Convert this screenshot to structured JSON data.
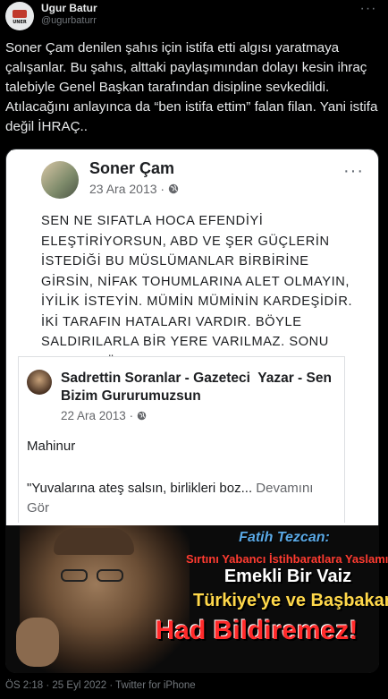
{
  "author": {
    "name": "Ugur Batur",
    "handle": "@ugurbaturr",
    "avatar_logo_text": "UNER"
  },
  "more_glyph": "···",
  "tweet_text": "Soner Çam denilen şahıs için istifa etti algısı yaratmaya çalışanlar. Bu şahıs, alttaki paylaşımından dolayı kesin ihraç talebiyle Genel Başkan tarafından disipline sevkedildi. Atılacağını anlayınca da “ben istifa ettim” falan filan. Yani istifa değil İHRAÇ..",
  "facebook_post": {
    "name": "Soner Çam",
    "date": "23 Ara 2013 · ",
    "globe_icon": "globe-icon",
    "dots": "···",
    "text": "SEN NE SIFATLA HOCA EFENDİYİ ELEŞTİRİYORSUN, ABD VE ŞER GÜÇLERİN İSTEDİĞİ BU MÜSLÜMANLAR BİRBİRİNE GİRSİN, NİFAK TOHUMLARINA ALET OLMAYIN, İYİLİK İSTEYİN. MÜMİN MÜMİNİN KARDEŞİDİR. İKİ TARAFIN HATALARI VARDIR. BÖYLE SALDIRILARLA BİR YERE VARILMAZ. SONU GELMEZ. ÜLKE KAYBEDER.",
    "shared": {
      "name": "Sadrettin Soranlar - Gazeteci  Yazar - Sen Bizim Gururumuzsun",
      "date": "22 Ara 2013 · ",
      "author_line": "Mahinur",
      "text": "\"Yuvalarına ateş salsın, birlikleri boz... ",
      "see_more": "Devamını Gör"
    }
  },
  "video_overlay": {
    "line1": "Fatih Tezcan:",
    "line2": "Sırtını Yabancı İstihbaratlara Yaslamış",
    "line3": "Emekli Bir Vaiz",
    "line4": "Türkiye'ye ve Başbakana",
    "line5": "Had Bildiremez!"
  },
  "footer": "ÖS 2:18 · 25 Eyl 2022 · Twitter for iPhone"
}
